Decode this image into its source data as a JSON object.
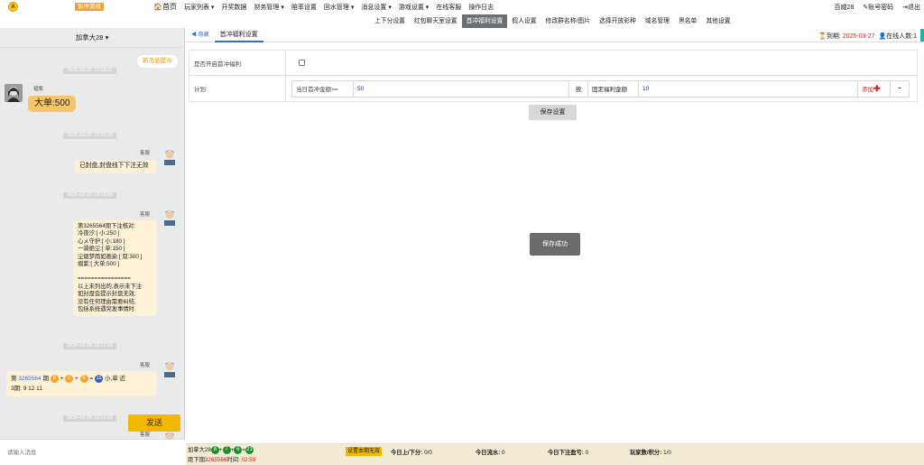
{
  "topbar": {
    "logo": "A",
    "pause": "暂停游戏",
    "nav": [
      "首页",
      "玩家列表 ▾",
      "开奖数据",
      "财务管理 ▾",
      "赔率设置",
      "回水管理 ▾",
      "消息设置 ▾",
      "游戏设置 ▾",
      "在线客服",
      "操作日志"
    ],
    "right": [
      "百威28",
      "账号密码",
      "退出"
    ]
  },
  "subnav": {
    "items": [
      "上下分设置",
      "红包聊天室设置",
      "首冲福利设置",
      "假人设置",
      "修改群名称/图片",
      "选择开放彩种",
      "域名管理",
      "黑名单",
      "其他设置"
    ],
    "active": 2
  },
  "chat": {
    "room": "加拿大28 ▾",
    "new_msg": "新消息提示",
    "input_placeholder": "请输入消息",
    "send": "发送",
    "t1": "2025-03-25 13:16:01",
    "n1": "褶紫",
    "b1": "大单:500",
    "t2": "2025-03-25 13:16:29",
    "n2": "客服",
    "b2": "已封盘,封盘线下下注无效",
    "t3": "2025-03-25 13:16:54",
    "n3": "客服",
    "b3": [
      "第3265564期下注核对:",
      "冷夜汐:[ 小:250 ]",
      "心メ守护:[ 小:180 ]",
      "一骑绝尘:[ 单:150 ]",
      "尘烟梦雨如画染:[ 双:300 ]",
      "褶紫:[ 大单:500 ]",
      "",
      "================",
      "以上未列出的,表示未下注",
      "如封盘会提示封盘无效,",
      "没有任何理由需要纠结,",
      "包括系统遇突发事情时."
    ],
    "t4": "2025-03-25 13:17:15",
    "n4": "客服",
    "b4a": "第",
    "b4period": "3265564",
    "b4b": "期",
    "b4balls": [
      "6",
      "0",
      "5",
      "11"
    ],
    "b4ops": [
      "+",
      "+",
      "="
    ],
    "b4c": "小,单 近",
    "b4d": "3期: 9 12 11",
    "t5": "2025-03-25 13:17:15",
    "n5": "客服"
  },
  "main": {
    "back": "◀ 隐藏",
    "tab": "首冲福利设置",
    "expire_label": "到期:",
    "expire_date": "2025-03-27",
    "online": "在线人数:1",
    "row1_label": "是否开启首冲福利:",
    "row2_label": "计划:",
    "cond_label": "当日首冲金额>=",
    "cond_value": "50",
    "by": "按",
    "fixed_label": "固定福利金额",
    "fixed_value": "10",
    "add": "添加",
    "minus": "━",
    "save": "保存设置",
    "toast": "保存成功"
  },
  "bottom": {
    "game": "加拿大28",
    "balls": [
      "8",
      "7",
      "6",
      "21"
    ],
    "next_label": "距下期",
    "next_period": "3265566",
    "time_label": "时间:",
    "time": "02:59",
    "invalid_btn": "设置本期无效",
    "updown": "今日上/下分:",
    "updown_v": "0/0",
    "flow": "今日流水:",
    "flow_v": "0",
    "profit": "今日下注盈亏:",
    "profit_v": "0",
    "score": "玩家数/积分:",
    "score_v": "1/0"
  }
}
